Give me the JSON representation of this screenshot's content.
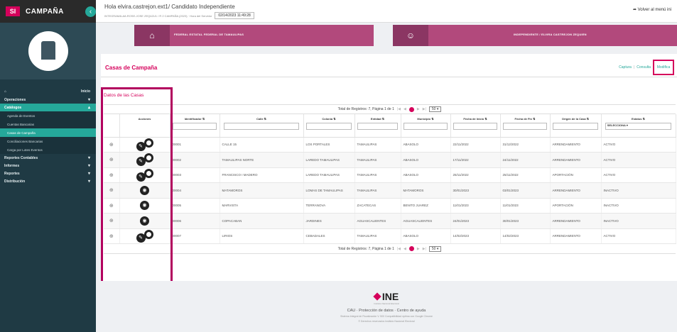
{
  "app": {
    "logo_mark": "SI",
    "logo_text": "CAMPAÑA"
  },
  "header": {
    "greeting": "Hola elvira.castrejon.ext1/ Candidato Independiente",
    "sub_info": "INTEGRAM4LA8-ROSE-JOSE ZEQ4ZU1 / R 2 CAMPAÑA (2023) · Hora del Servidor",
    "server_time": "02/14/2023 11:49:28",
    "back_link": "Volver al menú ini"
  },
  "banners": [
    {
      "label": "FEDERAL ESTATAL FEDERAL DE TAMAULIPAS"
    },
    {
      "label": "INDEPENDIENTE / ELVIRA CASTREJON ZEQUIEN"
    }
  ],
  "sidebar": {
    "items": [
      {
        "label": "Inicio",
        "type": "home"
      },
      {
        "label": "Operaciones",
        "type": "group",
        "chevron": "▾"
      },
      {
        "label": "Catálogos",
        "type": "active",
        "chevron": "▴"
      },
      {
        "label": "Agenda de Eventos",
        "type": "sub"
      },
      {
        "label": "Cuentas Bancarias",
        "type": "sub"
      },
      {
        "label": "Casas de Campaña",
        "type": "sub-active"
      },
      {
        "label": "Conciliaciones Bancarias",
        "type": "sub"
      },
      {
        "label": "Carga por Lotes Eventos",
        "type": "sub"
      },
      {
        "label": "Reportes Contables",
        "type": "group",
        "chevron": "▾"
      },
      {
        "label": "Informes",
        "type": "group",
        "chevron": "▾"
      },
      {
        "label": "Reportes",
        "type": "group",
        "chevron": "▾"
      },
      {
        "label": "Distribución",
        "type": "group",
        "chevron": "▾"
      }
    ]
  },
  "main": {
    "title": "Casas de Campaña",
    "actions": {
      "captura": "Captura",
      "consulta": "Consulta",
      "modifica": "Modifica",
      "sep": "|"
    },
    "section_title": "Datos de las Casas",
    "pager": {
      "text": "Total de Registros: 7, Página 1 de 1",
      "page_size": "50 ▾"
    },
    "pager_bottom": {
      "text": "Total de Registros: 7, Página 1 de 1",
      "page_size": "50 ▾"
    },
    "columns": [
      "",
      "Acciones",
      "Identificador",
      "Calle",
      "Colonia",
      "Entidad",
      "Municipio",
      "Fecha de Inicio",
      "Fecha de Fin",
      "Origen de la Casa",
      "Estatus"
    ],
    "status_filter": "SELECCIONA ▾",
    "rows": [
      {
        "actions": [
          "edit",
          "disable"
        ],
        "id": "00001",
        "calle": "CALLE 15",
        "colonia": "LOS PORTALES",
        "entidad": "TAMAULIPAS",
        "municipio": "ABASOLO",
        "inicio": "22/11/2022",
        "fin": "31/12/2022",
        "origen": "ARRENDAMIENTO",
        "estatus": "ACTIVO"
      },
      {
        "actions": [
          "edit",
          "disable"
        ],
        "id": "00002",
        "calle": "TAMAULIPAS NORTE",
        "colonia": "LAREDO TAMAULIPAS",
        "entidad": "TAMAULIPAS",
        "municipio": "ABASOLO",
        "inicio": "17/11/2022",
        "fin": "24/11/2022",
        "origen": "ARRENDAMIENTO",
        "estatus": "ACTIVO"
      },
      {
        "actions": [
          "edit",
          "disable"
        ],
        "id": "00003",
        "calle": "FRANCISCO I MADERO",
        "colonia": "LAREDO TAMAULIPAS",
        "entidad": "TAMAULIPAS",
        "municipio": "ABASOLO",
        "inicio": "25/11/2022",
        "fin": "25/11/2022",
        "origen": "APORTACIÓN",
        "estatus": "ACTIVO"
      },
      {
        "actions": [
          "enable"
        ],
        "id": "00004",
        "calle": "MATAMOROS",
        "colonia": "LOMAS DE TAMAULIPAS",
        "entidad": "TAMAULIPAS",
        "municipio": "MATAMOROS",
        "inicio": "30/01/2023",
        "fin": "03/01/2023",
        "origen": "ARRENDAMIENTO",
        "estatus": "INACTIVO"
      },
      {
        "actions": [
          "enable"
        ],
        "id": "00005",
        "calle": "MARVISTA",
        "colonia": "TERRANOVA",
        "entidad": "ZACATECAS",
        "municipio": "BENITO JUAREZ",
        "inicio": "11/01/2023",
        "fin": "11/01/2023",
        "origen": "APORTACIÓN",
        "estatus": "INACTIVO"
      },
      {
        "actions": [
          "enable"
        ],
        "id": "00006",
        "calle": "COPACABAN",
        "colonia": "JARDINES",
        "entidad": "AGUASCALIENTES",
        "municipio": "AGUASCALIENTES",
        "inicio": "24/01/2023",
        "fin": "30/01/2023",
        "origen": "ARRENDAMIENTO",
        "estatus": "INACTIVO"
      },
      {
        "actions": [
          "edit",
          "disable"
        ],
        "id": "00007",
        "calle": "LIRIOS",
        "colonia": "CEBADALES",
        "entidad": "TAMAULIPAS",
        "municipio": "ABASOLO",
        "inicio": "14/02/2023",
        "fin": "14/02/2023",
        "origen": "ARRENDAMIENTO",
        "estatus": "ACTIVO"
      }
    ]
  },
  "footer": {
    "logo": "INE",
    "logo_sub": "Instituto Nacional Electoral",
    "links": "CAU · Protección de datos · Centro de ayuda",
    "note1": "Sistema Integral de Fiscalización V. 500 Compatibilidad óptima con Google Chrome",
    "note2": "© Derechos reservados Instituto Nacional Electoral"
  },
  "colors": {
    "accent": "#d5005b",
    "sidebar": "#1f3a44",
    "teal": "#25a89a",
    "banner": "#b2497c"
  }
}
